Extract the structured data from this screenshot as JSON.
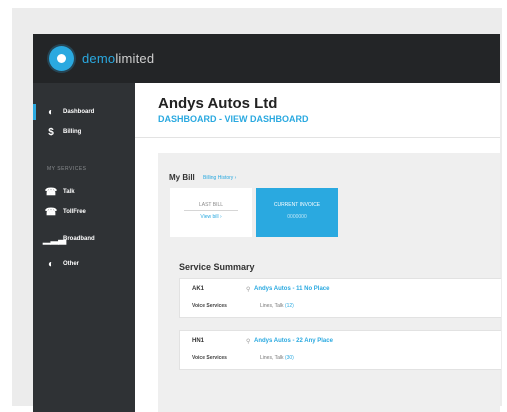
{
  "brand": {
    "part1": "demo",
    "part2": "limited",
    "accent": "#2aa9e0"
  },
  "sidebar": {
    "items": [
      {
        "icon": "gauge-icon",
        "label": "Dashboard"
      },
      {
        "icon": "dollar-icon",
        "label": "Billing"
      }
    ],
    "section_label": "MY SERVICES",
    "services": [
      {
        "icon": "phone-icon",
        "label": "Talk"
      },
      {
        "icon": "phone-icon",
        "label": "TollFree"
      },
      {
        "icon": "broadband-icon",
        "label": "Broadband"
      },
      {
        "icon": "gauge-icon",
        "label": "Other"
      }
    ]
  },
  "header": {
    "company": "Andys Autos Ltd",
    "breadcrumb": "DASHBOARD - VIEW DASHBOARD"
  },
  "bill": {
    "title": "My Bill",
    "history_link": "Billing History ›",
    "last_bill": {
      "label": "LAST BILL",
      "link": "View bill ›"
    },
    "current_invoice": {
      "label": "CURRENT INVOICE",
      "sub": "0000000"
    }
  },
  "service_summary": {
    "title": "Service Summary",
    "services": [
      {
        "code": "AK1",
        "address": "Andys Autos - 11 No Place",
        "label": "Voice Services",
        "lines": "Lines, Talk",
        "count": "(12)"
      },
      {
        "code": "HN1",
        "address": "Andys Autos - 22 Any Place",
        "label": "Voice Services",
        "lines": "Lines, Talk",
        "count": "(30)"
      }
    ]
  }
}
